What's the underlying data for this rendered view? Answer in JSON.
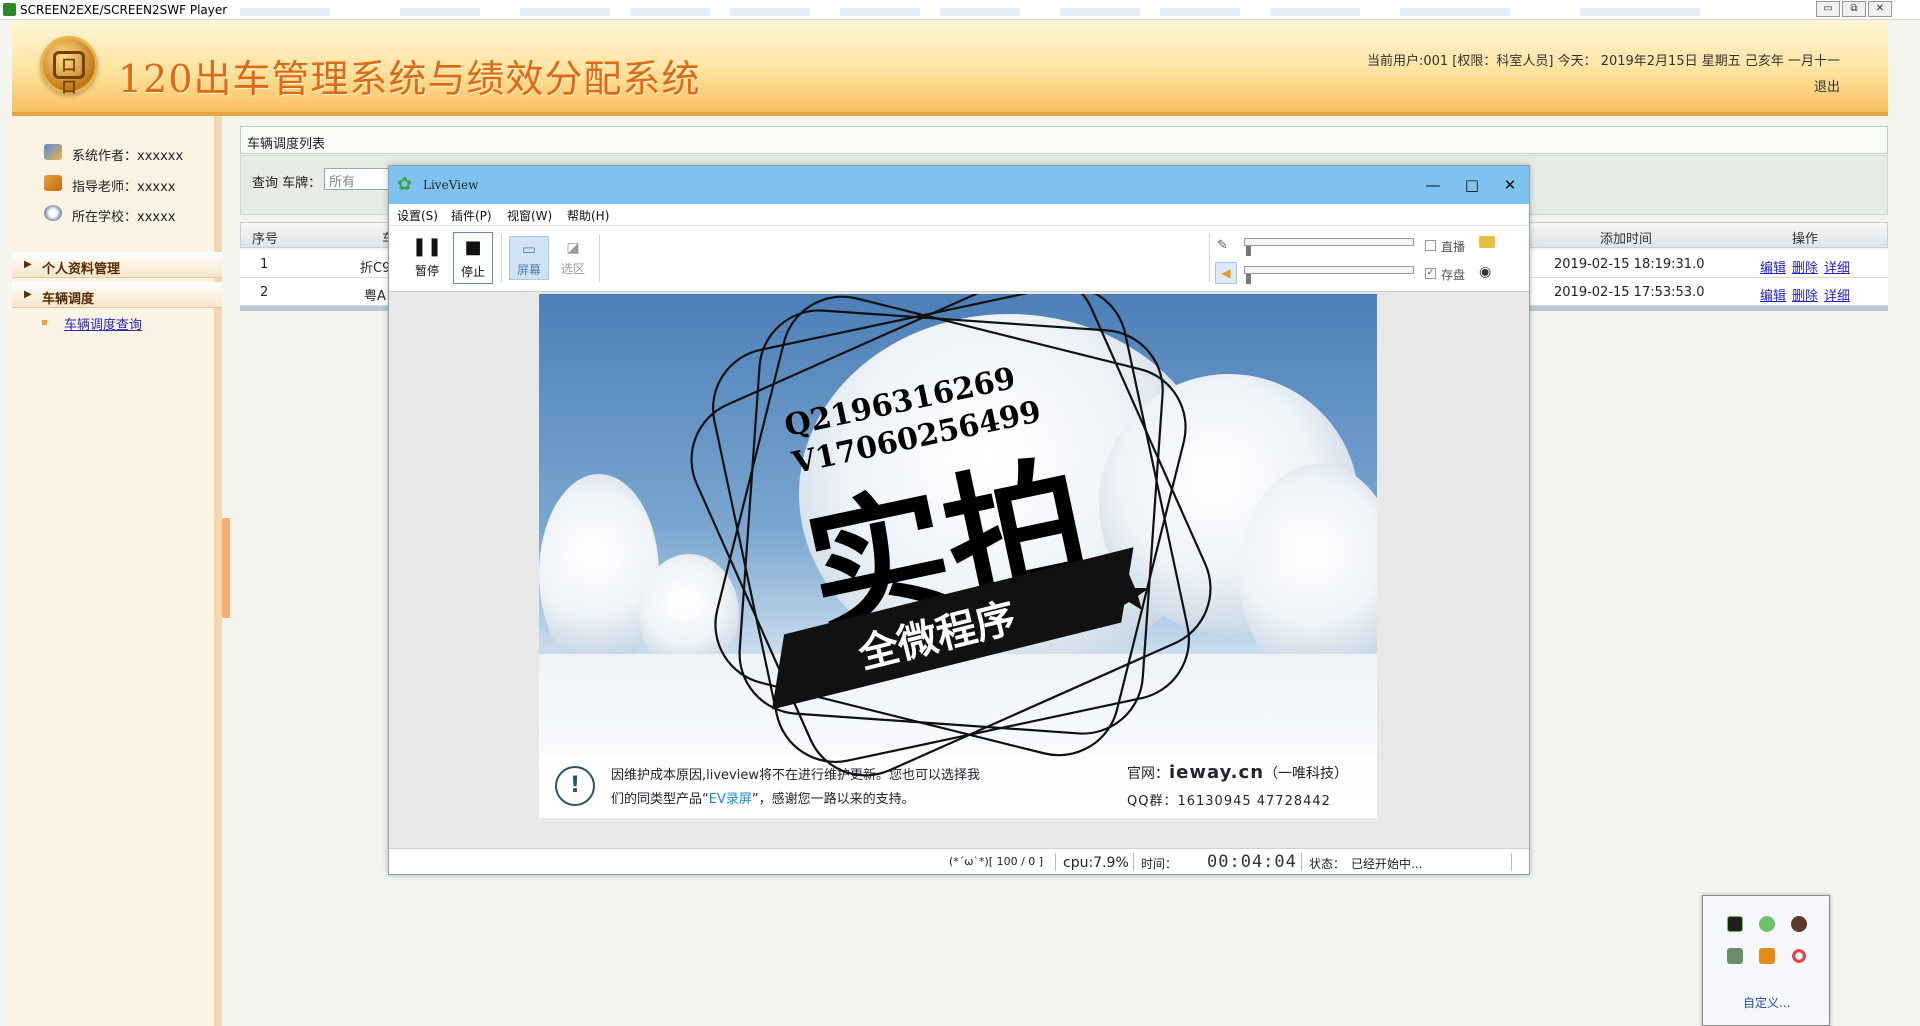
{
  "player": {
    "title": "SCREEN2EXE/SCREEN2SWF Player",
    "btn_min": "▭",
    "btn_restore": "⧉",
    "btn_close": "✕"
  },
  "header": {
    "title": "120出车管理系统与绩效分配系统",
    "user_info": "当前用户:001 [权限：科室人员] 今天： 2019年2月15日 星期五 己亥年 一月十一",
    "logout": "退出",
    "logo_text": "口口"
  },
  "sidebar": {
    "info": [
      {
        "icon": "author-icon",
        "label": "系统作者：xxxxxx"
      },
      {
        "icon": "teacher-icon",
        "label": "指导老师：xxxxx"
      },
      {
        "icon": "school-icon",
        "label": "所在学校：xxxxx"
      }
    ],
    "menus": [
      {
        "label": "个人资料管理"
      },
      {
        "label": "车辆调度"
      }
    ],
    "sub_link": "车辆调度查询"
  },
  "content": {
    "panel_title": "车辆调度列表",
    "query_label": "查询 车牌：",
    "query_value": "所有",
    "columns": {
      "seq": "序号",
      "plate": "车",
      "added": "添加时间",
      "ops": "操作"
    },
    "rows": [
      {
        "seq": "1",
        "plate": "折C9",
        "added": "2019-02-15 18:19:31.0",
        "edit": "编辑",
        "del": "删除",
        "detail": "详细"
      },
      {
        "seq": "2",
        "plate": "粤A",
        "added": "2019-02-15 17:53:53.0",
        "edit": "编辑",
        "del": "删除",
        "detail": "详细"
      }
    ]
  },
  "liveview": {
    "title": "LiveView",
    "win_min": "—",
    "win_max": "□",
    "win_close": "✕",
    "menu": [
      "设置(S)",
      "插件(P)",
      "视窗(W)",
      "帮助(H)"
    ],
    "toolbar": {
      "pause": "暂停",
      "stop": "停止",
      "screen": "屏幕",
      "region": "选区"
    },
    "live_label": "直播",
    "save_label": "存盘",
    "save_checked": "✓",
    "stamp": {
      "line1": "Q2196316269",
      "line2": "V17060256499",
      "big": "实拍",
      "banner": "全微程序"
    },
    "notice": {
      "line1": "因维护成本原因,liveview将不在进行维护更新。您也可以选择我",
      "line2a": "们的同类型产品“",
      "line2b": "EV录屏",
      "line2c": "”，感谢您一路以来的支持。",
      "site_label": "官网：",
      "site": "ieway.cn",
      "site_suffix": "（一唯科技）",
      "qq": "QQ群：16130945 47728442"
    },
    "status": {
      "face": "(*´ω`*)[ 100 / 0 ]",
      "cpu": "cpu:7.9%",
      "time_label": "时间：",
      "time": "00:04:04",
      "state_label": "状态：",
      "state": "已经开始中..."
    }
  },
  "tray": {
    "customize": "自定义..."
  },
  "colors": {
    "title_orange": "#e06a14",
    "lv_titlebar": "#7ec3ef",
    "link_blue": "#2222cc"
  }
}
